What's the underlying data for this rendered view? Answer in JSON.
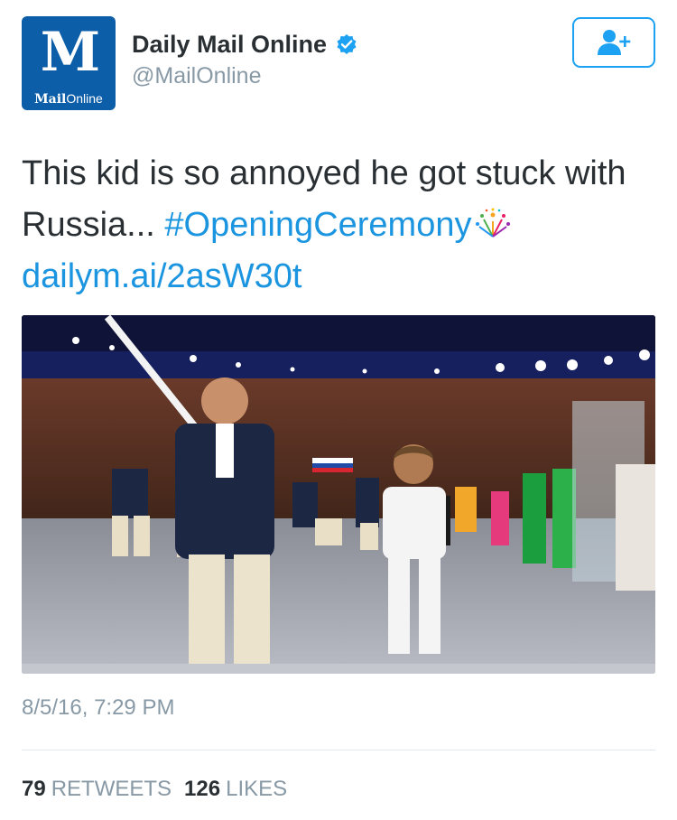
{
  "account": {
    "display_name": "Daily Mail Online",
    "handle": "@MailOnline",
    "verified": true,
    "avatar_logo_mark": "M",
    "avatar_logo_text_bold": "Mail",
    "avatar_logo_text": "Online",
    "avatar_color": "#0d5ea8"
  },
  "follow_button": {
    "icon": "add-user-icon",
    "color": "#1da1f2"
  },
  "tweet": {
    "text_line1": "This kid is so annoyed he got stuck with",
    "text_line2_prefix": "Russia... ",
    "hashtag": "#OpeningCeremony",
    "emoji": "fireworks-icon",
    "link": "dailym.ai/2asW30t",
    "link_color": "#1b95e0"
  },
  "media": {
    "type": "photo",
    "content": "olympic-opening-ceremony-russia-flag-bearer-photo"
  },
  "timestamp": "8/5/16, 7:29 PM",
  "stats": {
    "retweets_count": "79",
    "retweets_label": "RETWEETS",
    "likes_count": "126",
    "likes_label": "LIKES"
  }
}
